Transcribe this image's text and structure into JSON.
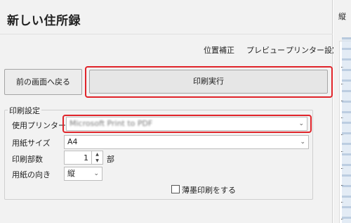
{
  "app": {
    "title": "新しい住所録"
  },
  "top_links": [
    "位置補正",
    "プレビュー",
    "プリンター設定"
  ],
  "buttons": {
    "back": "前の画面へ戻る",
    "print": "印刷実行"
  },
  "print_settings": {
    "group_label": "印刷設定",
    "printer": {
      "label": "使用プリンター",
      "value": "Microsoft Print to PDF"
    },
    "paper_size": {
      "label": "用紙サイズ",
      "value": "A4"
    },
    "copies": {
      "label": "印刷部数",
      "value": "1",
      "unit": "部"
    },
    "orientation": {
      "label": "用紙の向き",
      "value": "縦"
    },
    "light_ink": {
      "label": "薄墨印刷をする",
      "checked": false
    }
  },
  "preview": {
    "title": "縦"
  },
  "colors": {
    "highlight": "#e0242a"
  }
}
